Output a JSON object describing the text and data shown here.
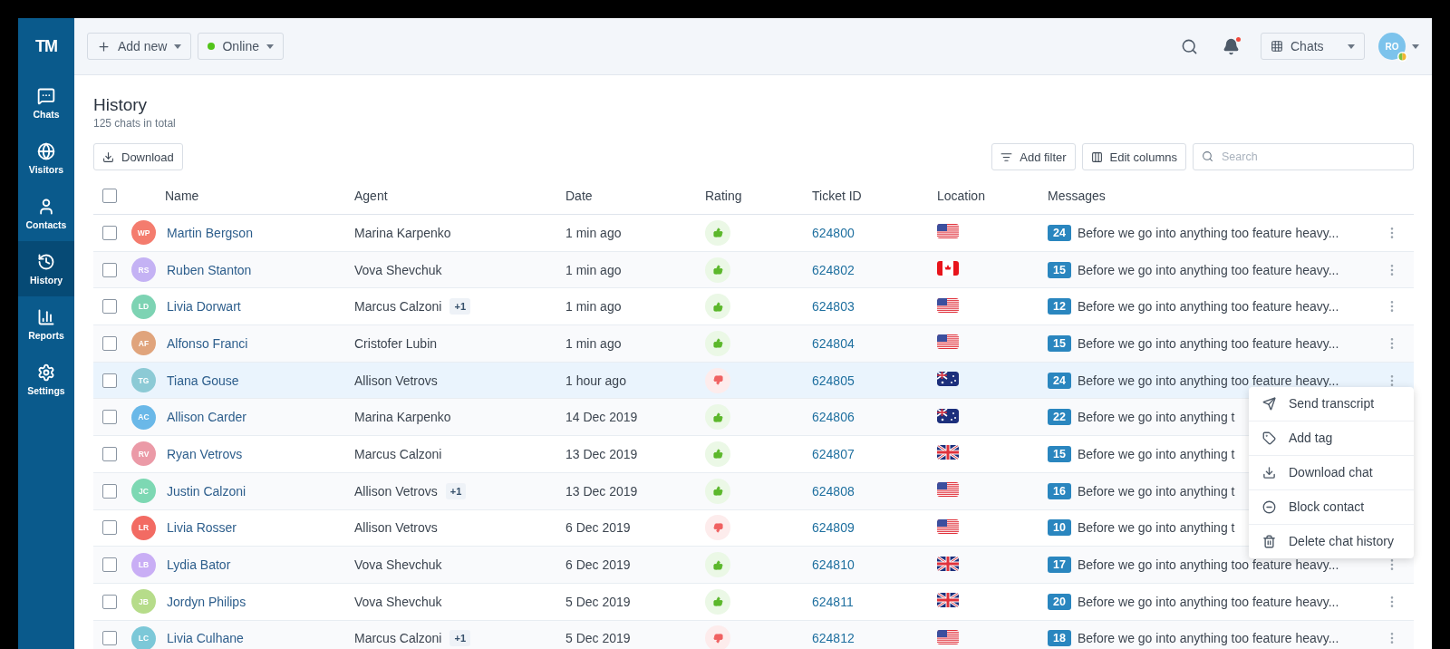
{
  "sidebar": {
    "logo": "TM",
    "items": [
      {
        "kind": "chats",
        "label": "Chats",
        "selected": false
      },
      {
        "kind": "visitors",
        "label": "Visitors",
        "selected": false
      },
      {
        "kind": "contacts",
        "label": "Contacts",
        "selected": false
      },
      {
        "kind": "history",
        "label": "History",
        "selected": true
      },
      {
        "kind": "reports",
        "label": "Reports",
        "selected": false
      },
      {
        "kind": "settings",
        "label": "Settings",
        "selected": false
      }
    ]
  },
  "topbar": {
    "add_button": "Add new",
    "status": {
      "label": "Online",
      "color": "#52c41a"
    },
    "notifications_unread": true,
    "view_select": "Chats",
    "user_initials": "RO"
  },
  "page": {
    "title": "History",
    "subtitle": "125 chats in total",
    "download_button": "Download",
    "filter_button": "Add filter",
    "columns_button": "Edit columns",
    "search": {
      "placeholder": "Search"
    }
  },
  "table": {
    "select_all_checked": false,
    "columns": [
      "Name",
      "Agent",
      "Date",
      "Rating",
      "Ticket ID",
      "Location",
      "Messages"
    ],
    "rows": [
      {
        "initials": "WP",
        "color": "#f47c6e",
        "name": "Martin Bergson",
        "agent": "Marina Karpenko",
        "date": "1 min ago",
        "positive": true,
        "ticket": "624800",
        "location": {
          "kind": "us"
        },
        "count": "24",
        "message": "Before we go into anything too feature heavy...",
        "checked": false,
        "highlighted": false
      },
      {
        "initials": "RS",
        "color": "#c4b2f4",
        "name": "Ruben Stanton",
        "agent": "Vova Shevchuk",
        "date": "1 min ago",
        "positive": true,
        "ticket": "624802",
        "location": {
          "kind": "ca"
        },
        "count": "15",
        "message": "Before we go into anything too feature heavy...",
        "checked": false,
        "highlighted": false
      },
      {
        "initials": "LD",
        "color": "#7dd3b3",
        "name": "Livia Dorwart",
        "agent": "Marcus Calzoni",
        "extra": "+1",
        "date": "1 min ago",
        "positive": true,
        "ticket": "624803",
        "location": {
          "kind": "us"
        },
        "count": "12",
        "message": "Before we go into anything too feature heavy...",
        "checked": false,
        "highlighted": false
      },
      {
        "initials": "AF",
        "color": "#e0a47c",
        "name": "Alfonso Franci",
        "agent": "Cristofer Lubin",
        "date": "1 min ago",
        "positive": true,
        "ticket": "624804",
        "location": {
          "kind": "us"
        },
        "count": "15",
        "message": "Before we go into anything too feature heavy...",
        "checked": false,
        "highlighted": false
      },
      {
        "initials": "TG",
        "color": "#8ccad5",
        "name": "Tiana Gouse",
        "agent": "Allison Vetrovs",
        "date": "1 hour ago",
        "positive": false,
        "ticket": "624805",
        "location": {
          "kind": "au"
        },
        "count": "24",
        "message": "Before we go into anything too feature heavy...",
        "checked": false,
        "highlighted": true,
        "menu": [
          {
            "kind": "send",
            "label": "Send transcript"
          },
          {
            "kind": "tag",
            "label": "Add tag"
          },
          {
            "kind": "download",
            "label": "Download chat"
          },
          {
            "kind": "block",
            "label": "Block contact"
          },
          {
            "kind": "delete",
            "label": "Delete chat history"
          }
        ]
      },
      {
        "initials": "AC",
        "color": "#6ab8e8",
        "name": "Allison Carder",
        "agent": "Marina Karpenko",
        "date": "14 Dec 2019",
        "positive": true,
        "ticket": "624806",
        "location": {
          "kind": "au"
        },
        "count": "22",
        "message": "Before we go into anything t",
        "checked": false,
        "highlighted": false
      },
      {
        "initials": "RV",
        "color": "#eb9aa7",
        "name": "Ryan Vetrovs",
        "agent": "Marcus Calzoni",
        "date": "13 Dec 2019",
        "positive": true,
        "ticket": "624807",
        "location": {
          "kind": "gb"
        },
        "count": "15",
        "message": "Before we go into anything t",
        "checked": false,
        "highlighted": false
      },
      {
        "initials": "JC",
        "color": "#7dd8b3",
        "name": "Justin Calzoni",
        "agent": "Allison Vetrovs",
        "extra": "+1",
        "date": "13 Dec 2019",
        "positive": true,
        "ticket": "624808",
        "location": {
          "kind": "us"
        },
        "count": "16",
        "message": "Before we go into anything t",
        "checked": false,
        "highlighted": false
      },
      {
        "initials": "LR",
        "color": "#f26b63",
        "name": "Livia Rosser",
        "agent": "Allison Vetrovs",
        "date": "6 Dec 2019",
        "positive": false,
        "ticket": "624809",
        "location": {
          "kind": "us"
        },
        "count": "10",
        "message": "Before we go into anything t",
        "checked": false,
        "highlighted": false
      },
      {
        "initials": "LB",
        "color": "#c9aef5",
        "name": "Lydia Bator",
        "agent": "Vova Shevchuk",
        "date": "6 Dec 2019",
        "positive": true,
        "ticket": "624810",
        "location": {
          "kind": "gb"
        },
        "count": "17",
        "message": "Before we go into anything too feature heavy...",
        "checked": false,
        "highlighted": false
      },
      {
        "initials": "JB",
        "color": "#b6dc8a",
        "name": "Jordyn Philips",
        "agent": "Vova Shevchuk",
        "date": "5 Dec 2019",
        "positive": true,
        "ticket": "624811",
        "location": {
          "kind": "gb"
        },
        "count": "20",
        "message": "Before we go into anything too feature heavy...",
        "checked": false,
        "highlighted": false
      },
      {
        "initials": "LC",
        "color": "#7cc8d8",
        "name": "Livia Culhane",
        "agent": "Marcus Calzoni",
        "extra": "+1",
        "date": "5 Dec 2019",
        "positive": false,
        "ticket": "624812",
        "location": {
          "kind": "us"
        },
        "count": "18",
        "message": "Before we go into anything too feature heavy...",
        "checked": false,
        "highlighted": false
      }
    ]
  }
}
